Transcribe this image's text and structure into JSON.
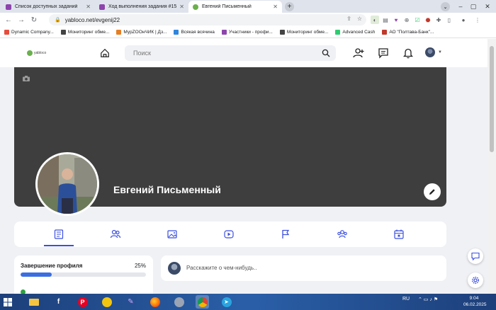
{
  "browser": {
    "tabs": [
      {
        "label": "Список доступных заданий",
        "active": false,
        "favicon_color": "#8e44ad"
      },
      {
        "label": "Ход выполнения задания #155",
        "active": false,
        "favicon_color": "#8e44ad"
      },
      {
        "label": "Евгений Письменный",
        "active": true,
        "favicon_color": "#6ab04c"
      }
    ],
    "new_tab": "+",
    "url": "yabloco.net/evgenij22",
    "bookmarks": [
      {
        "label": "Dynamic Company...",
        "color": "#e74c3c"
      },
      {
        "label": "Мониторинг обме...",
        "color": "#444"
      },
      {
        "label": "МурZOOнЧИК | Дз...",
        "color": "#e67e22"
      },
      {
        "label": "Всякая всячина",
        "color": "#2e86de"
      },
      {
        "label": "Участники - профи...",
        "color": "#8e44ad"
      },
      {
        "label": "Мониторинг обме...",
        "color": "#444"
      },
      {
        "label": "Advanced Cash",
        "color": "#2ecc71"
      },
      {
        "label": "АО \"Полтава-Банк\"...",
        "color": "#c0392b"
      }
    ]
  },
  "site": {
    "logo_text": "yabloco",
    "search_placeholder": "Поиск"
  },
  "profile": {
    "name": "Евгений Письменный",
    "tab_icons": [
      "feed-icon",
      "friends-icon",
      "photos-icon",
      "video-icon",
      "flag-icon",
      "groups-icon",
      "calendar-icon"
    ]
  },
  "completion": {
    "title": "Завершение профиля",
    "percent_label": "25%",
    "percent": 25
  },
  "post": {
    "prompt": "Расскажите о чем-нибудь.."
  },
  "taskbar": {
    "lang": "RU",
    "time": "9:04",
    "date": "06.02.2025"
  },
  "colors": {
    "accent": "#3b4fe0",
    "cover": "#3e3e3e",
    "progress": "#3b6ee0"
  }
}
